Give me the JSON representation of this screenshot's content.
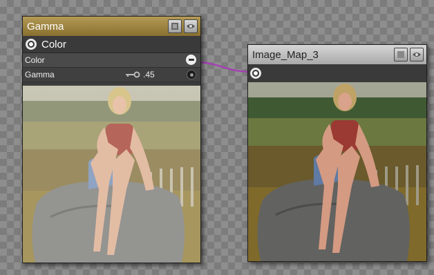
{
  "gamma_node": {
    "title": "Gamma",
    "output_label": "Color",
    "params": [
      {
        "label": "Color"
      },
      {
        "label": "Gamma",
        "value": ".45"
      }
    ]
  },
  "map_node": {
    "title": "Image_Map_3"
  },
  "colors": {
    "wire": "#a53fb5",
    "gamma_title_bar": "#a88b45",
    "map_title_bar": "#c6c6c6",
    "node_body": "#3c3c3c"
  },
  "icons": {
    "menu": "menu-icon",
    "eye": "eye-icon",
    "socket": "socket-icon",
    "key": "key-icon"
  }
}
